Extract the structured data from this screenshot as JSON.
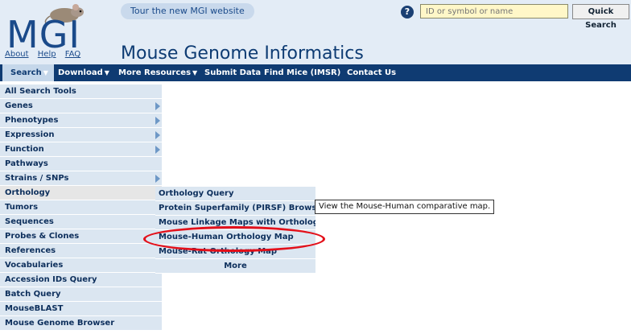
{
  "header": {
    "logo_text": "MGI",
    "links": [
      "About",
      "Help",
      "FAQ"
    ],
    "tour_label": "Tour the new MGI website",
    "site_title": "Mouse Genome Informatics",
    "help_symbol": "?",
    "search_placeholder": "ID or symbol or name",
    "quick_search_label": "Quick Search"
  },
  "nav": {
    "items": [
      {
        "label": "Search",
        "has_caret": true,
        "active": true
      },
      {
        "label": "Download",
        "has_caret": true
      },
      {
        "label": "More Resources",
        "has_caret": true
      },
      {
        "label": "Submit Data"
      },
      {
        "label": "Find Mice (IMSR)"
      },
      {
        "label": "Contact Us"
      }
    ]
  },
  "search_menu": {
    "items": [
      {
        "label": "All Search Tools"
      },
      {
        "label": "Genes",
        "has_submenu": true
      },
      {
        "label": "Phenotypes",
        "has_submenu": true
      },
      {
        "label": "Expression",
        "has_submenu": true
      },
      {
        "label": "Function",
        "has_submenu": true
      },
      {
        "label": "Pathways"
      },
      {
        "label": "Strains / SNPs",
        "has_submenu": true
      },
      {
        "label": "Orthology",
        "active": true
      },
      {
        "label": "Tumors"
      },
      {
        "label": "Sequences"
      },
      {
        "label": "Probes & Clones"
      },
      {
        "label": "References"
      },
      {
        "label": "Vocabularies"
      },
      {
        "label": "Accession IDs Query"
      },
      {
        "label": "Batch Query"
      },
      {
        "label": "MouseBLAST"
      },
      {
        "label": "Mouse Genome Browser"
      }
    ]
  },
  "orthology_submenu": {
    "items": [
      {
        "label": "Orthology Query"
      },
      {
        "label": "Protein Superfamily (PIRSF) Browser"
      },
      {
        "label": "Mouse Linkage Maps with Orthologs"
      },
      {
        "label": "Mouse-Human Orthology Map",
        "highlighted": true
      },
      {
        "label": "Mouse-Rat Orthology Map"
      },
      {
        "label": "More"
      }
    ]
  },
  "tooltip": "View the Mouse-Human comparative map.",
  "colors": {
    "nav_bg": "#0f3b72",
    "menu_bg": "#dbe6f1",
    "header_bg": "#e3ecf6",
    "highlight": "#e3101a"
  }
}
